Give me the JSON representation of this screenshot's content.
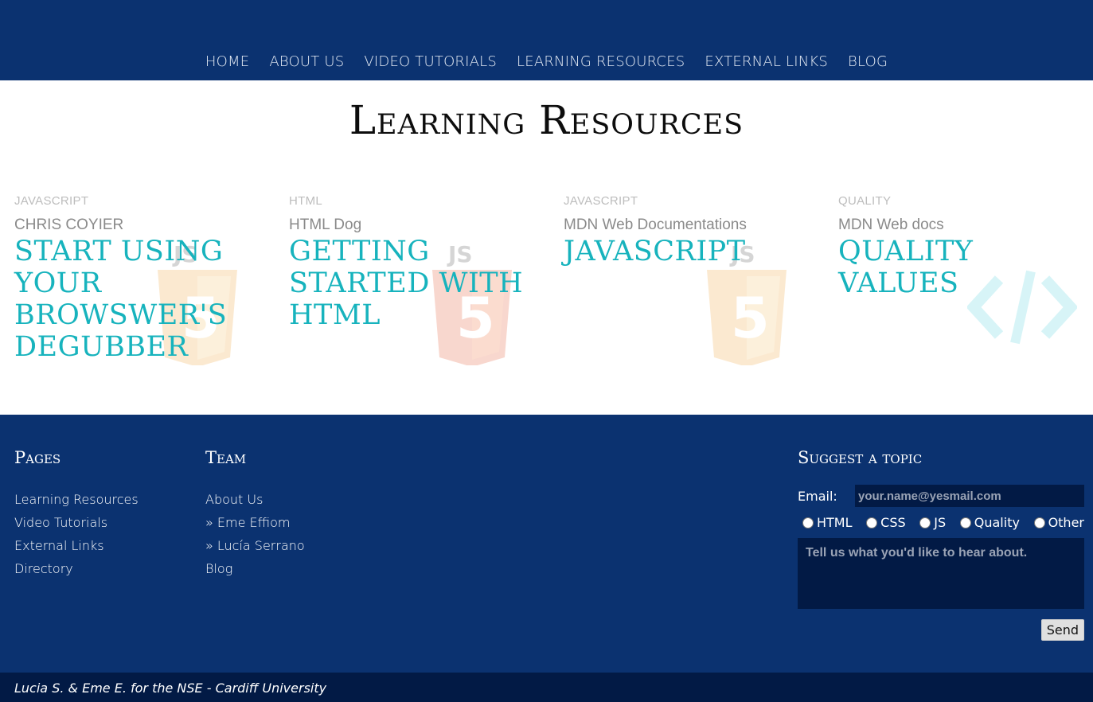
{
  "nav": {
    "items": [
      "HOME",
      "ABOUT US",
      "VIDEO TUTORIALS",
      "LEARNING RESOURCES",
      "EXTERNAL LINKS",
      "BLOG"
    ]
  },
  "page": {
    "title": "Learning Resources"
  },
  "cards": [
    {
      "category": "JAVASCRIPT",
      "author": "CHRIS COYIER",
      "title": "START USING YOUR BROWSWER'S DEGUBBER",
      "icon": "js-html5-icon"
    },
    {
      "category": "HTML",
      "author": "HTML Dog",
      "title": "GETTING STARTED WITH HTML",
      "icon": "html5-icon"
    },
    {
      "category": "JAVASCRIPT",
      "author": "MDN Web Documentations",
      "title": "JAVASCRIPT",
      "icon": "js-html5-icon"
    },
    {
      "category": "QUALITY",
      "author": "MDN Web docs",
      "title": "QUALITY VALUES",
      "icon": "code-icon"
    }
  ],
  "footer": {
    "pages": {
      "heading": "Pages",
      "items": [
        "Learning Resources",
        "Video Tutorials",
        "External Links",
        "Directory"
      ]
    },
    "team": {
      "heading": "Team",
      "items": [
        "About Us",
        "»  Eme Effiom",
        "»  Lucía Serrano",
        "Blog"
      ]
    },
    "suggest": {
      "heading": "Suggest a topic",
      "email_label": "Email:",
      "email_placeholder": "your.name@yesmail.com",
      "options": [
        "HTML",
        "CSS",
        "JS",
        "Quality",
        "Other"
      ],
      "message_placeholder": "Tell us what you'd like to hear about.",
      "send_label": "Send"
    },
    "credit": "Lucia S. & Eme E. for the NSE - Cardiff University"
  },
  "colors": {
    "navy": "#0b3270",
    "dark_navy": "#021a45",
    "teal": "#17b3bd"
  }
}
